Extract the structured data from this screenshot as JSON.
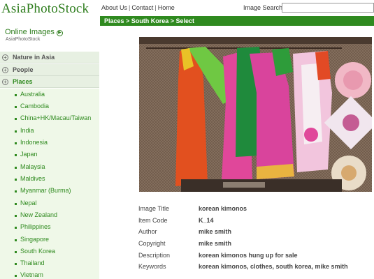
{
  "logo_text": "AsiaPhotoStock",
  "topnav": {
    "about": "About Us",
    "contact": "Contact",
    "home": "Home",
    "separator": "|"
  },
  "search": {
    "label": "Image Search",
    "value": ""
  },
  "breadcrumb": "Places > South Korea > Select",
  "sidebar": {
    "title": "Online Images",
    "subtitle": "AsiaPhotoStock",
    "categories": [
      {
        "label": "Nature in Asia"
      },
      {
        "label": "People"
      },
      {
        "label": "Places"
      }
    ],
    "places": [
      "Australia",
      "Cambodia",
      "China+HK/Macau/Taiwan",
      "India",
      "Indonesia",
      "Japan",
      "Malaysia",
      "Maldives",
      "Myanmar (Burma)",
      "Nepal",
      "New Zealand",
      "Philippines",
      "Singapore",
      "South Korea",
      "Thailand",
      "Vietnam"
    ]
  },
  "details": [
    {
      "key": "Image Title",
      "value": "korean kimonos"
    },
    {
      "key": "Item Code",
      "value": "K_14"
    },
    {
      "key": "Author",
      "value": "mike smith"
    },
    {
      "key": "Copyright",
      "value": "mike smith"
    },
    {
      "key": "Description",
      "value": "korean kimonos hung up for sale"
    },
    {
      "key": "Keywords",
      "value": "korean kimonos, clothes, south korea, mike smith"
    }
  ],
  "colors": {
    "brand_green": "#2f8a1f",
    "sidebar_bg": "#eff8e8",
    "category_bg": "#e7f0e2"
  }
}
